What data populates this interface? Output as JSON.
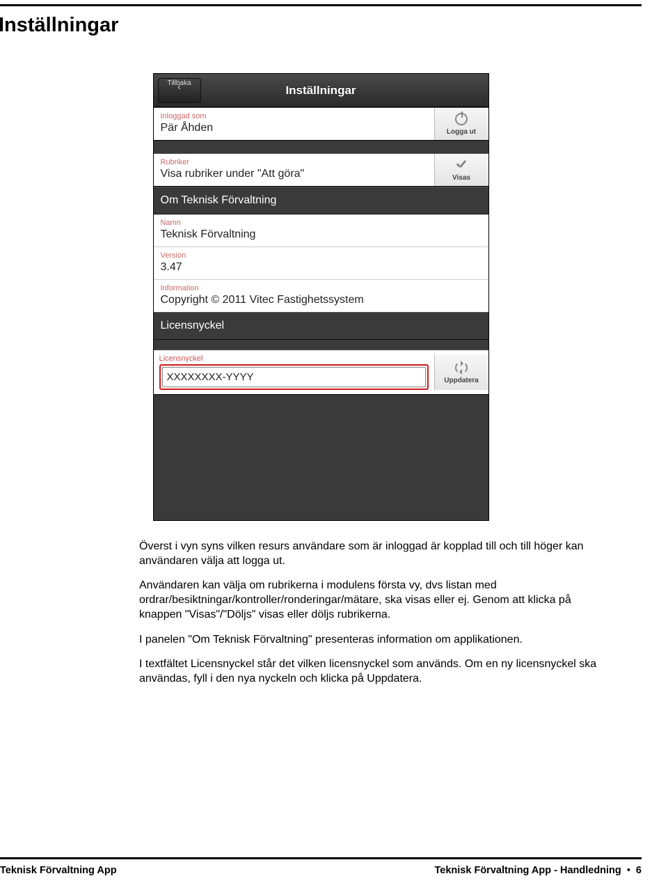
{
  "page": {
    "heading": "Inställningar"
  },
  "phone": {
    "back_label": "Tillbaka",
    "title": "Inställningar",
    "logged_in": {
      "label": "Inloggad som",
      "value": "Pär Åhden",
      "action": "Logga ut"
    },
    "headings": {
      "label": "Rubriker",
      "value": "Visa rubriker under \"Att göra\"",
      "action": "Visas"
    },
    "about_header": "Om Teknisk Förvaltning",
    "name": {
      "label": "Namn",
      "value": "Teknisk Förvaltning"
    },
    "version": {
      "label": "Version",
      "value": "3.47"
    },
    "info": {
      "label": "Information",
      "value": "Copyright © 2011 Vitec Fastighetssystem"
    },
    "license_header": "Licensnyckel",
    "license": {
      "label": "Licensnyckel",
      "value": "XXXXXXXX-YYYY",
      "action": "Uppdatera"
    }
  },
  "body": {
    "p1": "Överst i vyn syns vilken resurs användare som är inloggad är kopplad till och till höger kan användaren välja att logga ut.",
    "p2": "Användaren kan välja om rubrikerna i modulens första vy, dvs listan med ordrar/besiktningar/kontroller/ronderingar/mätare, ska visas eller ej. Genom att klicka på knappen \"Visas\"/\"Döljs\" visas eller döljs rubrikerna.",
    "p3": "I panelen \"Om Teknisk Förvaltning\" presenteras information om applikationen.",
    "p4": "I textfältet Licensnyckel står det vilken licensnyckel som används. Om en ny licensnyckel ska användas, fyll i den nya nyckeln och klicka på Uppdatera."
  },
  "footer": {
    "left": "Teknisk Förvaltning App",
    "right_prefix": "Teknisk Förvaltning App -  Handledning",
    "page_no": "6"
  }
}
